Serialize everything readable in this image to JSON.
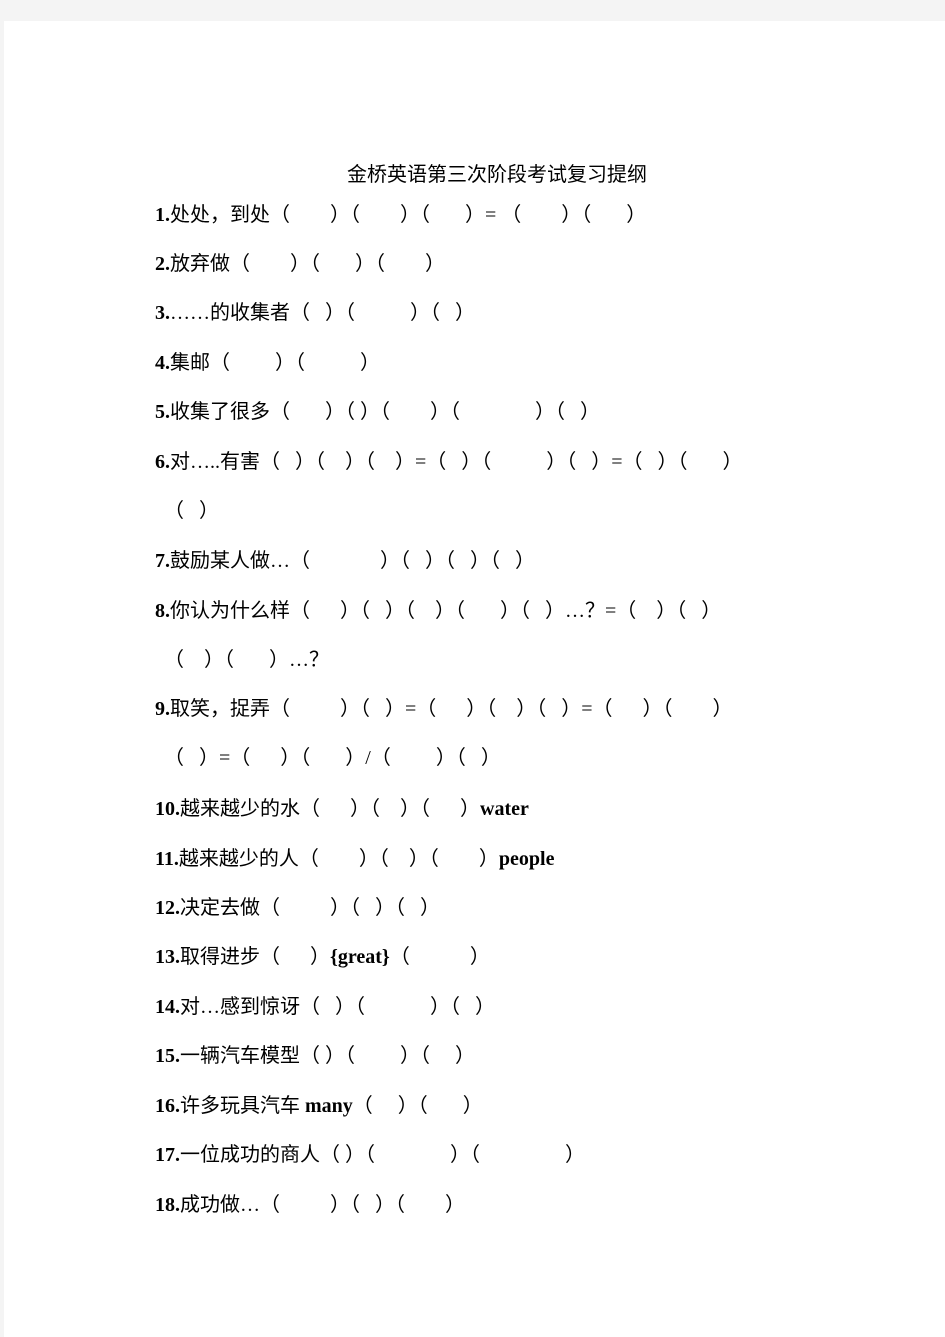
{
  "document": {
    "title": "金桥英语第三次阶段考试复习提纲",
    "lines": [
      {
        "num": "1.",
        "text": "处处，到处（        ）（        ）（       ）= （        ）（       ）"
      },
      {
        "num": "2.",
        "text": "放弃做（        ）（       ）（        ）"
      },
      {
        "num": "3.",
        "text": "……的收集者（   ）（           ）（   ）"
      },
      {
        "num": "4.",
        "text": "集邮（         ）（           ）"
      },
      {
        "num": "5.",
        "text": "收集了很多（       ）（ ）（        ）（               ）（   ）"
      },
      {
        "num": "6.",
        "text": "对…..有害（   ）（    ）（    ）=（   ）（           ）（   ）=（   ）（       ）"
      },
      {
        "num": "",
        "text": "（   ）"
      },
      {
        "num": "7.",
        "text": "鼓励某人做…（              ）（   ）（   ）（   ）"
      },
      {
        "num": "8.",
        "text": "你认为什么样（      ）（   ）（    ）（       ）（   ）…？=（    ）（   ）"
      },
      {
        "num": "",
        "text": "（    ）（       ）…？"
      },
      {
        "num": "9.",
        "text": "取笑，捉弄（          ）（   ）=（      ）（    ）（   ）=（      ）（        ）"
      },
      {
        "num": "",
        "text": "（   ）=（      ）（       ）/（         ）（   ）"
      },
      {
        "num": "10.",
        "text": "越来越少的水（      ）（    ）（      ）",
        "suffix": "water"
      },
      {
        "num": "11.",
        "text": "越来越少的人（        ）（    ）（        ）",
        "suffix": "people"
      },
      {
        "num": "12.",
        "text": "决定去做（          ）（   ）（   ）"
      },
      {
        "num": "13.",
        "text": "取得进步（      ）",
        "suffix": "{great}",
        "after": "（            ）"
      },
      {
        "num": "14.",
        "text": "对…感到惊讶（   ）（             ）（   ）"
      },
      {
        "num": "15.",
        "text": "一辆汽车模型（ ）（         ）（     ）"
      },
      {
        "num": "16.",
        "text": "许多玩具汽车 ",
        "suffix": "many",
        "after": "（     ）（       ）"
      },
      {
        "num": "17.",
        "text": "一位成功的商人（ ）（               ）（                 ）"
      },
      {
        "num": "18.",
        "text": "成功做…（          ）（   ）（        ）"
      }
    ]
  }
}
